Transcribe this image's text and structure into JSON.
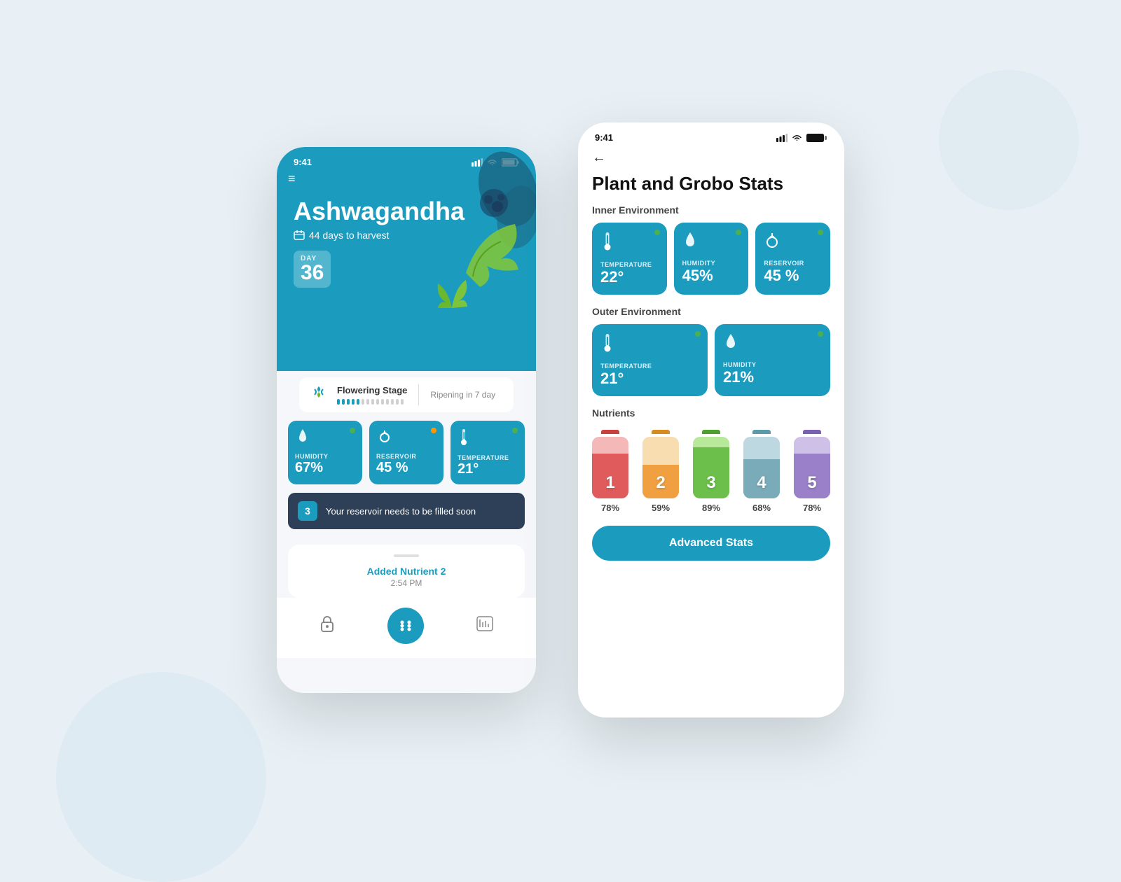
{
  "background": "#e8f0f5",
  "phone1": {
    "status_time": "9:41",
    "header_bg": "#1b9cbf",
    "plant_name": "Ashwagandha",
    "harvest_text": "44 days to harvest",
    "day_label": "DAY",
    "day_number": "36",
    "stage_name": "Flowering Stage",
    "stage_next": "Ripening in 7 day",
    "stats": [
      {
        "label": "HUMIDITY",
        "value": "67%",
        "icon": "💧",
        "dot_color": "#4caf50"
      },
      {
        "label": "RESERVOIR",
        "value": "45 %",
        "icon": "🫧",
        "dot_color": "#ff9800"
      },
      {
        "label": "TEMPERATURE",
        "value": "21°",
        "icon": "🌡",
        "dot_color": "#4caf50"
      }
    ],
    "alert_number": "3",
    "alert_text": "Your reservoir needs to be filled soon",
    "activity_prefix": "Added",
    "activity_highlight": "Nutrient 2",
    "activity_time": "2:54 PM"
  },
  "phone2": {
    "status_time": "9:41",
    "title": "Plant and Grobo Stats",
    "inner_env_label": "Inner Environment",
    "inner_env": [
      {
        "label": "TEMPERATURE",
        "value": "22°",
        "icon": "🌡",
        "dot_color": "#4caf50"
      },
      {
        "label": "HUMIDITY",
        "value": "45%",
        "icon": "💧",
        "dot_color": "#4caf50"
      },
      {
        "label": "RESERVOIR",
        "value": "45 %",
        "icon": "🫧",
        "dot_color": "#4caf50"
      }
    ],
    "outer_env_label": "Outer Environment",
    "outer_env": [
      {
        "label": "TEMPERATURE",
        "value": "21°",
        "icon": "🌡",
        "dot_color": "#4caf50"
      },
      {
        "label": "HUMIDITY",
        "value": "21%",
        "icon": "💧",
        "dot_color": "#4caf50"
      }
    ],
    "nutrients_label": "Nutrients",
    "nutrients": [
      {
        "number": "1",
        "pct": "78%",
        "fill_pct": 78,
        "color": "#e05c5c",
        "bg": "#f5b8b8",
        "nub": "#c94040"
      },
      {
        "number": "2",
        "pct": "59%",
        "fill_pct": 59,
        "color": "#f0a040",
        "bg": "#f8ddb0",
        "nub": "#d88c20"
      },
      {
        "number": "3",
        "pct": "89%",
        "fill_pct": 89,
        "color": "#6cbf4a",
        "bg": "#b8e89a",
        "nub": "#50a030"
      },
      {
        "number": "4",
        "pct": "68%",
        "fill_pct": 68,
        "color": "#7aabb8",
        "bg": "#bdd8e0",
        "nub": "#5a9aaa"
      },
      {
        "number": "5",
        "pct": "78%",
        "fill_pct": 78,
        "color": "#9980c8",
        "bg": "#cfc0e8",
        "nub": "#7a60b0"
      }
    ],
    "advanced_stats_label": "Advanced Stats"
  }
}
